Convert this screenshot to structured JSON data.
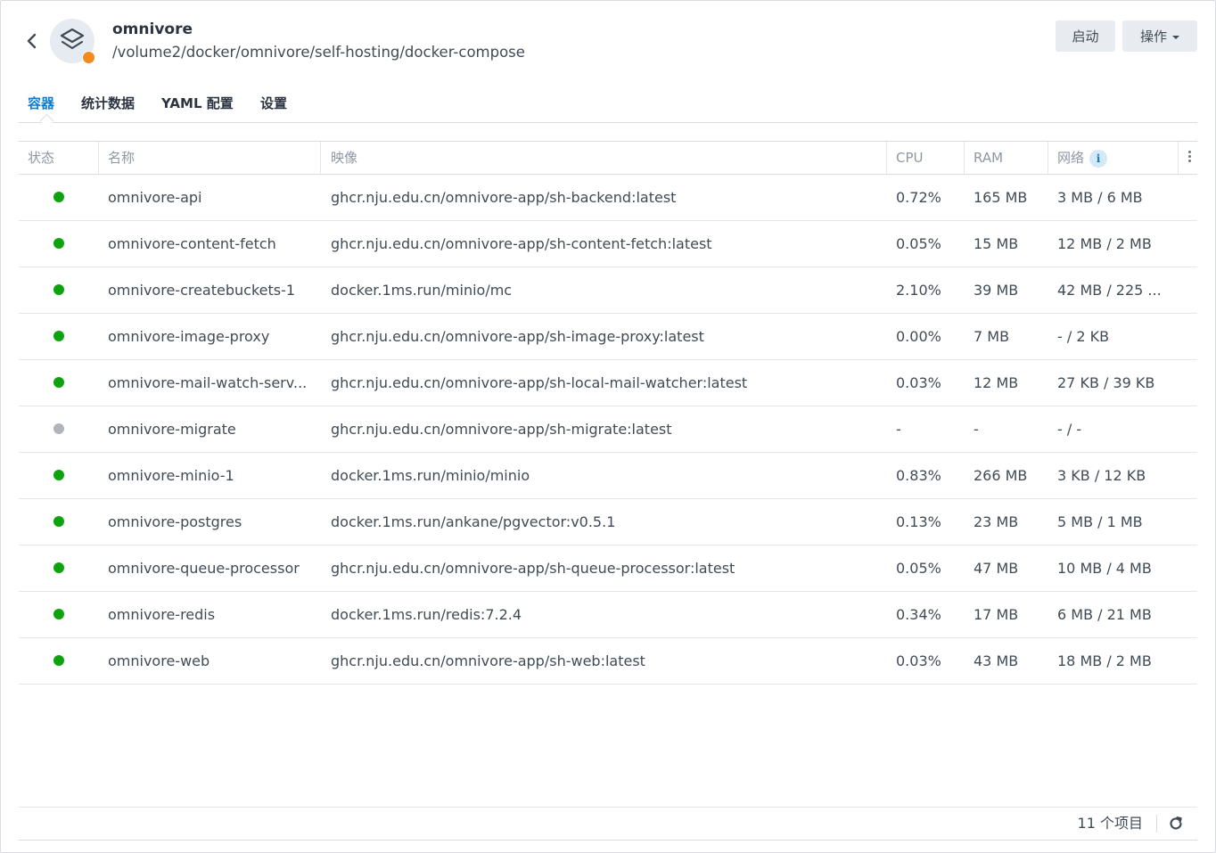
{
  "header": {
    "project_name": "omnivore",
    "project_path": "/volume2/docker/omnivore/self-hosting/docker-compose",
    "status_color": "#f28a1e",
    "start_label": "启动",
    "action_label": "操作"
  },
  "tabs": [
    {
      "label": "容器",
      "active": true
    },
    {
      "label": "统计数据",
      "active": false
    },
    {
      "label": "YAML 配置",
      "active": false
    },
    {
      "label": "设置",
      "active": false
    }
  ],
  "table": {
    "columns": {
      "status": "状态",
      "name": "名称",
      "image": "映像",
      "cpu": "CPU",
      "ram": "RAM",
      "network": "网络"
    },
    "rows": [
      {
        "status": "running",
        "name": "omnivore-api",
        "image": "ghcr.nju.edu.cn/omnivore-app/sh-backend:latest",
        "cpu": "0.72%",
        "ram": "165 MB",
        "network": "3 MB / 6 MB"
      },
      {
        "status": "running",
        "name": "omnivore-content-fetch",
        "image": "ghcr.nju.edu.cn/omnivore-app/sh-content-fetch:latest",
        "cpu": "0.05%",
        "ram": "15 MB",
        "network": "12 MB / 2 MB"
      },
      {
        "status": "running",
        "name": "omnivore-createbuckets-1",
        "image": "docker.1ms.run/minio/mc",
        "cpu": "2.10%",
        "ram": "39 MB",
        "network": "42 MB / 225 ..."
      },
      {
        "status": "running",
        "name": "omnivore-image-proxy",
        "image": "ghcr.nju.edu.cn/omnivore-app/sh-image-proxy:latest",
        "cpu": "0.00%",
        "ram": "7 MB",
        "network": "- / 2 KB"
      },
      {
        "status": "running",
        "name": "omnivore-mail-watch-serv...",
        "image": "ghcr.nju.edu.cn/omnivore-app/sh-local-mail-watcher:latest",
        "cpu": "0.03%",
        "ram": "12 MB",
        "network": "27 KB / 39 KB"
      },
      {
        "status": "stopped",
        "name": "omnivore-migrate",
        "image": "ghcr.nju.edu.cn/omnivore-app/sh-migrate:latest",
        "cpu": "-",
        "ram": "-",
        "network": "- / -"
      },
      {
        "status": "running",
        "name": "omnivore-minio-1",
        "image": "docker.1ms.run/minio/minio",
        "cpu": "0.83%",
        "ram": "266 MB",
        "network": "3 KB / 12 KB"
      },
      {
        "status": "running",
        "name": "omnivore-postgres",
        "image": "docker.1ms.run/ankane/pgvector:v0.5.1",
        "cpu": "0.13%",
        "ram": "23 MB",
        "network": "5 MB / 1 MB"
      },
      {
        "status": "running",
        "name": "omnivore-queue-processor",
        "image": "ghcr.nju.edu.cn/omnivore-app/sh-queue-processor:latest",
        "cpu": "0.05%",
        "ram": "47 MB",
        "network": "10 MB / 4 MB"
      },
      {
        "status": "running",
        "name": "omnivore-redis",
        "image": "docker.1ms.run/redis:7.2.4",
        "cpu": "0.34%",
        "ram": "17 MB",
        "network": "6 MB / 21 MB"
      },
      {
        "status": "running",
        "name": "omnivore-web",
        "image": "ghcr.nju.edu.cn/omnivore-app/sh-web:latest",
        "cpu": "0.03%",
        "ram": "43 MB",
        "network": "18 MB / 2 MB"
      }
    ]
  },
  "status_colors": {
    "running": "#0ea30e",
    "stopped": "#b1b5bb"
  },
  "footer": {
    "count_label": "11 个项目"
  },
  "icons": {
    "back": "chevron-left-icon",
    "project": "layers-icon",
    "info": "info-icon",
    "more": "kebab-icon",
    "refresh": "refresh-icon"
  }
}
